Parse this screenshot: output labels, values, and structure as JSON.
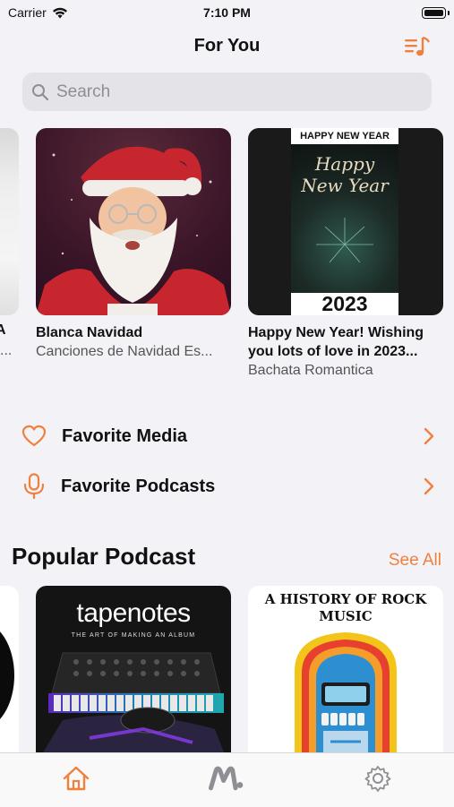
{
  "status": {
    "carrier": "Carrier",
    "time": "7:10 PM"
  },
  "header": {
    "title": "For You"
  },
  "search": {
    "placeholder": "Search"
  },
  "carousel": [
    {
      "title": "Blanca Navidad",
      "subtitle": "Canciones de Navidad Es..."
    },
    {
      "title": "Happy New Year! Wishing you lots of love in 2023...",
      "subtitle": "Bachata Romantica",
      "art_text": {
        "banner": "HAPPY NEW YEAR",
        "script": "Happy New Year",
        "year": "2023"
      }
    }
  ],
  "left_peek_text": [
    "A",
    "..."
  ],
  "favorites": [
    {
      "label": "Favorite Media",
      "icon": "heart-icon"
    },
    {
      "label": "Favorite Podcasts",
      "icon": "microphone-icon"
    }
  ],
  "popular": {
    "title": "Popular Podcast",
    "see_all": "See All",
    "items": [
      {
        "art_title": "tapenotes",
        "art_sub": "THE ART OF MAKING AN ALBUM"
      },
      {
        "art_title": "A HISTORY OF ROCK MUSIC"
      }
    ]
  },
  "tabs": [
    {
      "name": "home",
      "icon": "home-icon",
      "active": true
    },
    {
      "name": "music",
      "icon": "m-logo-icon",
      "active": false
    },
    {
      "name": "settings",
      "icon": "gear-icon",
      "active": false
    }
  ],
  "colors": {
    "accent": "#f0813d",
    "inactive": "#8e8e93"
  }
}
